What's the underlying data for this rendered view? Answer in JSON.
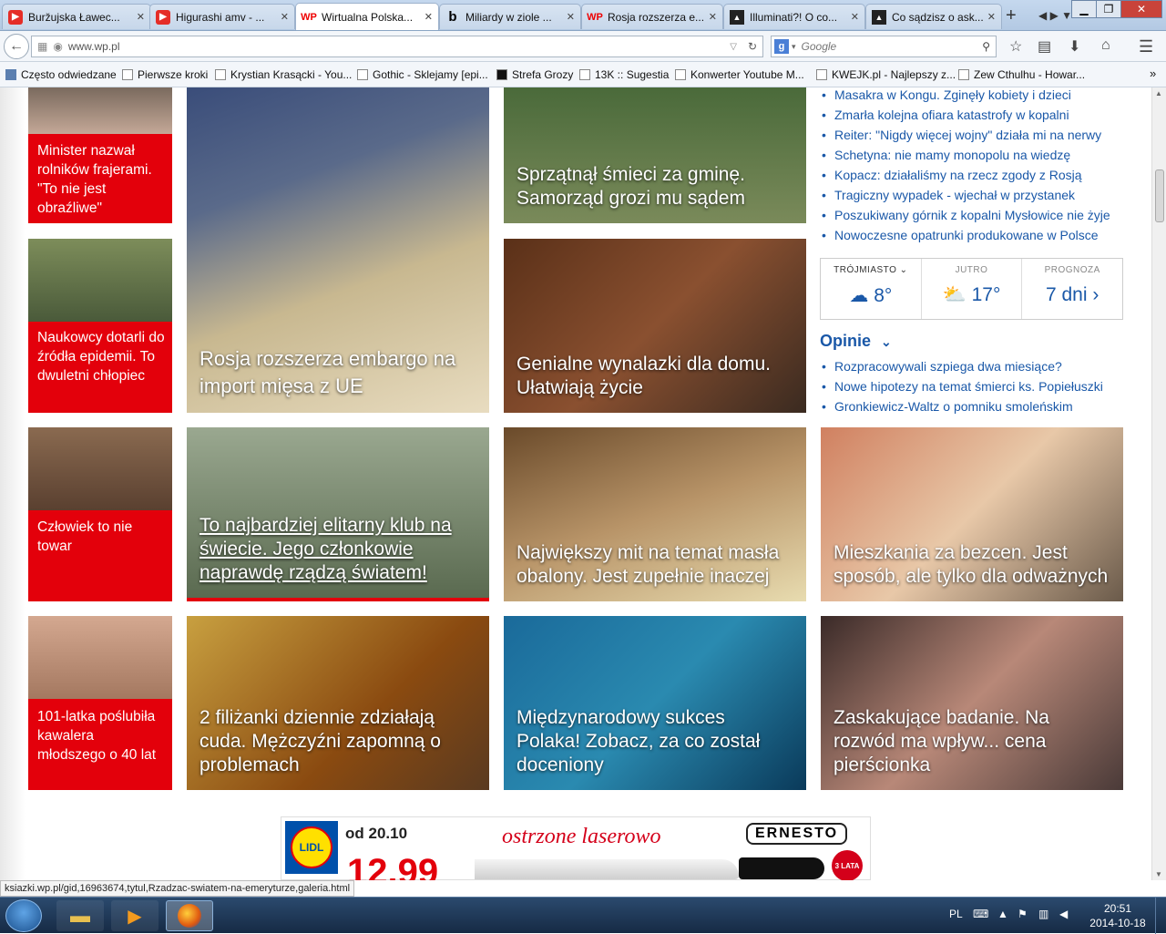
{
  "browser": {
    "tabs": [
      {
        "label": "Buržujska Ławec...",
        "icon": "youtube-icon"
      },
      {
        "label": "Higurashi amv - ...",
        "icon": "youtube-icon"
      },
      {
        "label": "Wirtualna Polska...",
        "icon": "wp-icon",
        "active": true
      },
      {
        "label": "Miliardy w ziole ...",
        "icon": "b-icon"
      },
      {
        "label": "Rosja rozszerza e...",
        "icon": "wp-icon"
      },
      {
        "label": "Illuminati?! O co...",
        "icon": "illuminati-icon"
      },
      {
        "label": "Co sądzisz o ask...",
        "icon": "illuminati-icon"
      }
    ],
    "url": "www.wp.pl",
    "search_placeholder": "Google",
    "bookmarks": [
      "Często odwiedzane",
      "Pierwsze kroki",
      "Krystian Krasącki - You...",
      "Gothic - Sklejamy [epi...",
      "Strefa Grozy",
      "13K :: Sugestia",
      "Konwerter Youtube M...",
      "KWEJK.pl - Najlepszy z...",
      "Zew Cthulhu - Howar..."
    ],
    "status_url": "ksiazki.wp.pl/gid,16963674,tytul,Rzadzac-swiatem-na-emeryturze,galeria.html"
  },
  "page": {
    "small_tiles": [
      {
        "caption": "Minister nazwał rolników frajerami. \"To nie jest obraźliwe\""
      },
      {
        "caption": "Naukowcy dotarli do źródła epidemii. To dwuletni chłopiec"
      },
      {
        "caption": "Człowiek to nie towar"
      },
      {
        "caption": "101-latka poślubiła kawalera młodszego o 40 lat"
      }
    ],
    "tiles": [
      {
        "caption": "Rosja rozszerza embargo na import mięsa z UE"
      },
      {
        "caption": "Sprzątnął śmieci za gminę. Samorząd grozi mu sądem"
      },
      {
        "caption": "Genialne wynalazki dla domu. Ułatwiają życie"
      },
      {
        "caption": "To najbardziej elitarny klub na świecie. Jego członkowie naprawdę rządzą światem!"
      },
      {
        "caption": "Największy mit na temat masła obalony. Jest zupełnie inaczej"
      },
      {
        "caption": "Mieszkania za bezcen. Jest sposób, ale tylko dla odważnych"
      },
      {
        "caption": "2 filiżanki dziennie zdziałają cuda. Mężczyźni zapomną o problemach"
      },
      {
        "caption": "Międzynarodowy sukces Polaka! Zobacz, za co został doceniony"
      },
      {
        "caption": "Zaskakujące badanie. Na rozwód ma wpływ... cena pierścionka"
      }
    ],
    "news": [
      "Masakra w Kongu. Zginęły kobiety i dzieci",
      "Zmarła kolejna ofiara katastrofy w kopalni",
      "Reiter: \"Nigdy więcej wojny\" działa mi na nerwy",
      "Schetyna: nie mamy monopolu na wiedzę",
      "Kopacz: działaliśmy na rzecz zgody z Rosją",
      "Tragiczny wypadek - wjechał w przystanek",
      "Poszukiwany górnik z kopalni Mysłowice nie żyje",
      "Nowoczesne opatrunki produkowane w Polsce"
    ],
    "weather": {
      "city": "TRÓJMIASTO",
      "today_temp": "8°",
      "tomorrow_label": "JUTRO",
      "tomorrow_temp": "17°",
      "forecast_label": "PROGNOZA",
      "forecast_value": "7 dni"
    },
    "opinie": {
      "title": "Opinie",
      "items": [
        "Rozpracowywali szpiega dwa miesiące?",
        "Nowe hipotezy na temat śmierci ks. Popiełuszki",
        "Gronkiewicz-Waltz o pomniku smoleńskim"
      ]
    },
    "ad": {
      "brand": "LIDL",
      "date": "od 20.10",
      "headline": "ostrzone laserowo",
      "product": "ERNESTO",
      "price": "12.99",
      "badge": "3 LATA"
    }
  },
  "taskbar": {
    "lang": "PL",
    "time": "20:51",
    "date": "2014-10-18"
  }
}
